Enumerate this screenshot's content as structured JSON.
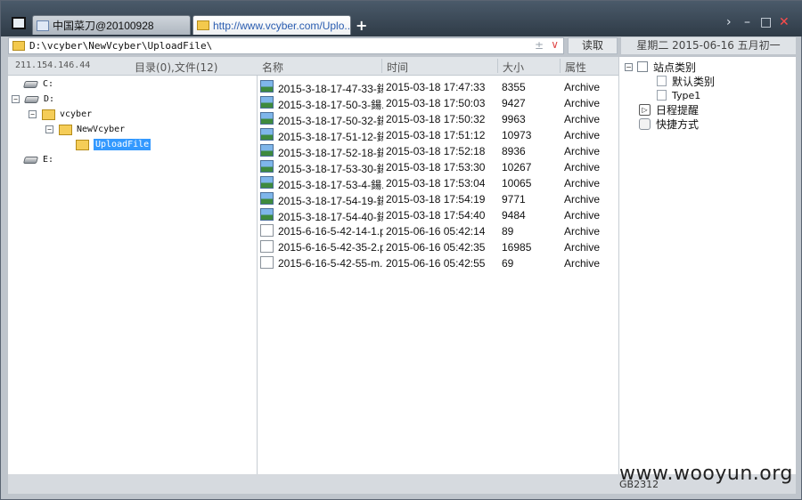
{
  "tabs": [
    {
      "label": "中国菜刀@20100928"
    },
    {
      "label": "http://www.vcyber.com/Uplo..."
    }
  ],
  "toolbar": {
    "address": "D:\\vcyber\\NewVcyber\\UploadFile\\",
    "address_pm": "±",
    "read_label": "读取",
    "date_info": "星期二 2015-06-16 五月初一"
  },
  "left_pane": {
    "ip": "211.154.146.44",
    "counts": "目录(0),文件(12)",
    "tree": [
      {
        "label": "C:"
      },
      {
        "label": "D:"
      },
      {
        "label": "vcyber"
      },
      {
        "label": "NewVcyber"
      },
      {
        "label": "UploadFile"
      },
      {
        "label": "E:"
      }
    ]
  },
  "file_list": {
    "columns": {
      "name": "名称",
      "time": "时间",
      "size": "大小",
      "attr": "属性"
    },
    "rows": [
      {
        "name": "2015-3-18-17-47-33-鍚...",
        "time": "2015-03-18 17:47:33",
        "size": "8355",
        "attr": "Archive",
        "icon": "image-file-icon"
      },
      {
        "name": "2015-3-18-17-50-3-鍚...",
        "time": "2015-03-18 17:50:03",
        "size": "9427",
        "attr": "Archive",
        "icon": "image-file-icon"
      },
      {
        "name": "2015-3-18-17-50-32-鍚...",
        "time": "2015-03-18 17:50:32",
        "size": "9963",
        "attr": "Archive",
        "icon": "image-file-icon"
      },
      {
        "name": "2015-3-18-17-51-12-鍚...",
        "time": "2015-03-18 17:51:12",
        "size": "10973",
        "attr": "Archive",
        "icon": "image-file-icon"
      },
      {
        "name": "2015-3-18-17-52-18-鍚...",
        "time": "2015-03-18 17:52:18",
        "size": "8936",
        "attr": "Archive",
        "icon": "image-file-icon"
      },
      {
        "name": "2015-3-18-17-53-30-鍚...",
        "time": "2015-03-18 17:53:30",
        "size": "10267",
        "attr": "Archive",
        "icon": "image-file-icon"
      },
      {
        "name": "2015-3-18-17-53-4-鍚...",
        "time": "2015-03-18 17:53:04",
        "size": "10065",
        "attr": "Archive",
        "icon": "image-file-icon"
      },
      {
        "name": "2015-3-18-17-54-19-鍚...",
        "time": "2015-03-18 17:54:19",
        "size": "9771",
        "attr": "Archive",
        "icon": "image-file-icon"
      },
      {
        "name": "2015-3-18-17-54-40-鍚...",
        "time": "2015-03-18 17:54:40",
        "size": "9484",
        "attr": "Archive",
        "icon": "image-file-icon"
      },
      {
        "name": "2015-6-16-5-42-14-1.php",
        "time": "2015-06-16 05:42:14",
        "size": "89",
        "attr": "Archive",
        "icon": "file-icon"
      },
      {
        "name": "2015-6-16-5-42-35-2.p...",
        "time": "2015-06-16 05:42:35",
        "size": "16985",
        "attr": "Archive",
        "icon": "file-icon"
      },
      {
        "name": "2015-6-16-5-42-55-m.a...",
        "time": "2015-06-16 05:42:55",
        "size": "69",
        "attr": "Archive",
        "icon": "file-icon"
      }
    ]
  },
  "side_pane": {
    "site_category": "站点类别",
    "default_category": "默认类别",
    "type1": "Type1",
    "schedule": "日程提醒",
    "shortcut": "快捷方式"
  },
  "status": {
    "encoding": "GB2312",
    "watermark": "www.wooyun.org"
  }
}
